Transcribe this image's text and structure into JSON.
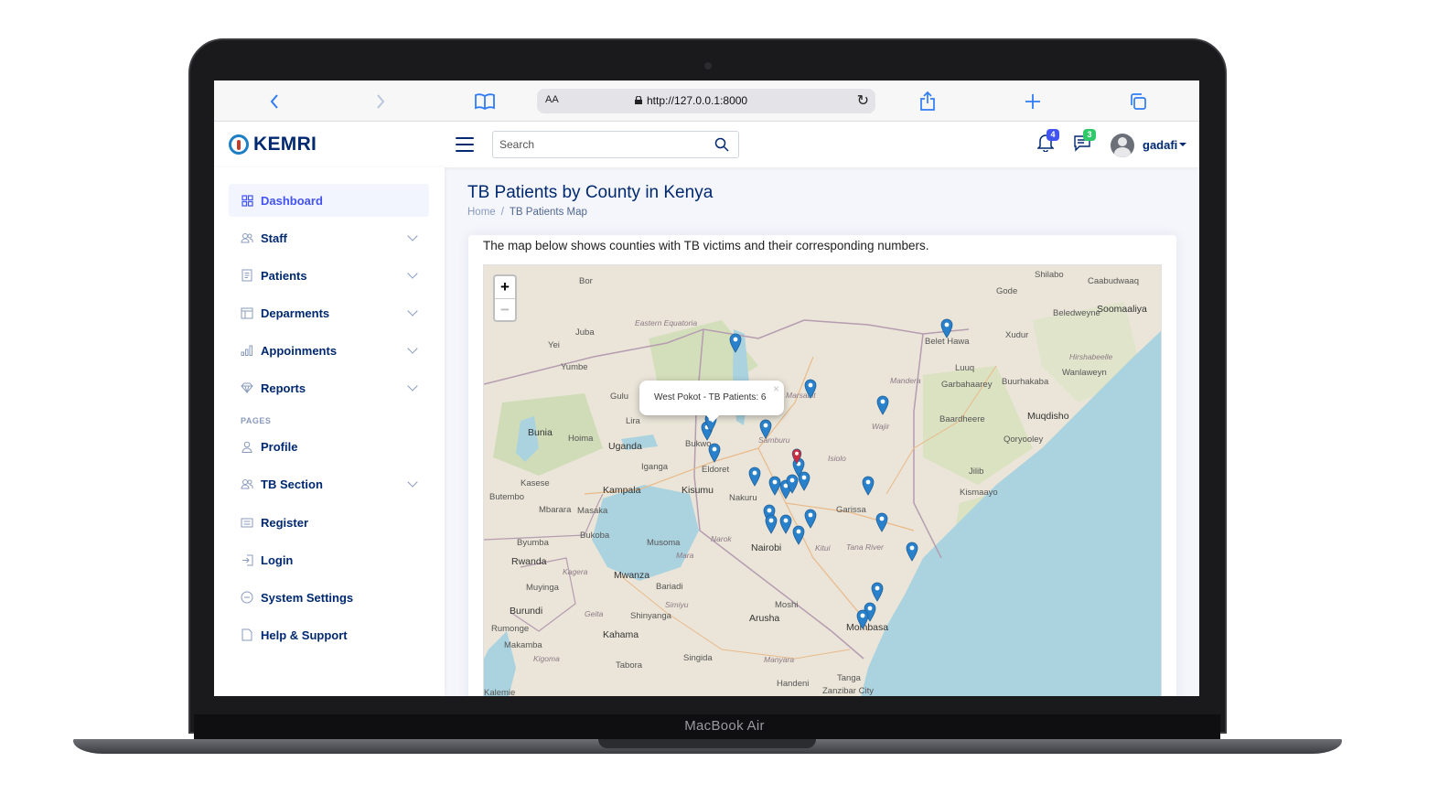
{
  "device": {
    "label": "MacBook Air"
  },
  "browser": {
    "url": "http://127.0.0.1:8000",
    "aa_label": "AA"
  },
  "header": {
    "logo_text": "KEMRI",
    "search_placeholder": "Search",
    "notifications_count": "4",
    "messages_count": "3",
    "username": "gadafi"
  },
  "sidebar": {
    "items": [
      {
        "label": "Dashboard",
        "icon": "grid-icon"
      },
      {
        "label": "Staff",
        "icon": "people-icon"
      },
      {
        "label": "Patients",
        "icon": "journal-icon"
      },
      {
        "label": "Deparments",
        "icon": "layout-icon"
      },
      {
        "label": "Appoinments",
        "icon": "bar-chart-icon"
      },
      {
        "label": "Reports",
        "icon": "gem-icon"
      }
    ],
    "pages_heading": "PAGES",
    "pages": [
      {
        "label": "Profile",
        "icon": "person-icon"
      },
      {
        "label": "TB Section",
        "icon": "people-icon"
      },
      {
        "label": "Register",
        "icon": "card-list-icon"
      },
      {
        "label": "Login",
        "icon": "box-arrow-in-icon"
      },
      {
        "label": "System Settings",
        "icon": "dash-circle-icon"
      },
      {
        "label": "Help & Support",
        "icon": "file-icon"
      }
    ]
  },
  "main": {
    "title": "TB Patients by County in Kenya",
    "breadcrumb": {
      "home": "Home",
      "current": "TB Patients Map"
    },
    "description": "The map below shows counties with TB victims and their corresponding numbers."
  },
  "map": {
    "zoom_in": "+",
    "zoom_out": "−",
    "popup_text": "West Pokot - TB Patients: 6",
    "popup_close": "×",
    "marker_color": "#2a81cb",
    "selected_marker_color": "#cb2b3e",
    "water_color": "#aad3df",
    "land_color": "#eae5d8",
    "places": [
      "Bor",
      "Juba",
      "Eastern Equatoria",
      "Yei",
      "Yumbe",
      "Gulu",
      "Lira",
      "Bunia",
      "Hoima",
      "Uganda",
      "Kasese",
      "Mbarara",
      "Butembo",
      "Masaka",
      "Kampala",
      "Iganga",
      "Kisumu",
      "Eldoret",
      "Bukwo",
      "Nakuru",
      "Nairobi",
      "Narok",
      "Kitui",
      "Garissa",
      "Tana River",
      "Isiolo",
      "Marsabit",
      "Samburu",
      "Wajir",
      "Mandera",
      "Luuq",
      "Gode",
      "Shilabo",
      "Xudur",
      "Garbahaarey",
      "Baardheere",
      "Jilib",
      "Kismaayo",
      "Muqdisho",
      "Qoryooley",
      "Buurhakaba",
      "Wanlaweyn",
      "Beledweyne",
      "Belet Hawa",
      "Hirshabeelle",
      "Soomaaliya",
      "Caabudwaaq",
      "Bukoba",
      "Musoma",
      "Mwanza",
      "Mara",
      "Bariadi",
      "Simiyu",
      "Shinyanga",
      "Geita",
      "Kagera",
      "Rwanda",
      "Burundi",
      "Byumba",
      "Muyinga",
      "Rumonge",
      "Makamba",
      "Kahama",
      "Kigoma",
      "Tabora",
      "Singida",
      "Manyara",
      "Arusha",
      "Moshi",
      "Handeni",
      "Tanga",
      "Mombasa",
      "Zanzibar City",
      "Kalemie"
    ]
  }
}
